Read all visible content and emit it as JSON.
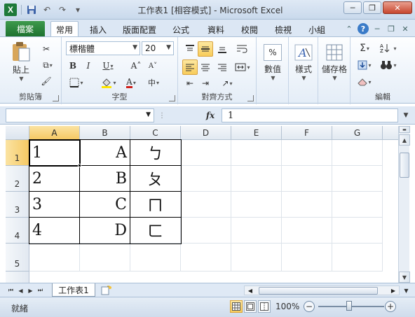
{
  "window": {
    "title": "工作表1 [相容模式] - Microsoft Excel",
    "app_icon": "X"
  },
  "qat": {
    "save_icon": "💾",
    "undo_icon": "↶",
    "redo_icon": "↷",
    "customize_icon": "▾"
  },
  "window_controls": {
    "minimize": "─",
    "restore": "❐",
    "close": "✕"
  },
  "ribbon_tabs": {
    "file": "檔案",
    "tabs": [
      "常用",
      "插入",
      "版面配置",
      "公式",
      "資料",
      "校閱",
      "檢視",
      "小組"
    ],
    "active": "常用"
  },
  "ribbon": {
    "clipboard": {
      "label": "剪貼簿",
      "paste": "貼上"
    },
    "font": {
      "label": "字型",
      "font_name": "標楷體",
      "font_size": "20",
      "bold": "B",
      "italic": "I",
      "underline": "U",
      "grow": "A˄",
      "shrink": "A˅",
      "font_color_letter": "A",
      "phonetic": "中"
    },
    "alignment": {
      "label": "對齊方式"
    },
    "number": {
      "label": "數值",
      "icon_text": "%"
    },
    "styles": {
      "label": "樣式"
    },
    "cells": {
      "label": "儲存格"
    },
    "editing": {
      "label": "編輯",
      "sum": "Σ"
    }
  },
  "formula_bar": {
    "name_box": "",
    "fx": "fx",
    "value": "1"
  },
  "sheet": {
    "columns": [
      "A",
      "B",
      "C",
      "D",
      "E",
      "F",
      "G"
    ],
    "rows": [
      "1",
      "2",
      "3",
      "4",
      "5"
    ],
    "active_column": "A",
    "active_row": "1",
    "cells": {
      "A": [
        "1",
        "2",
        "3",
        "4",
        ""
      ],
      "B": [
        "A",
        "B",
        "C",
        "D",
        ""
      ],
      "C": [
        "ㄅ",
        "ㄆ",
        "ㄇ",
        "ㄈ",
        ""
      ]
    }
  },
  "sheet_tabs": {
    "active": "工作表1"
  },
  "status": {
    "mode": "就緒",
    "zoom": "100%"
  },
  "colors": {
    "file_tab": "#1e7330",
    "highlight": "#f8cc5a",
    "accent": "#3a7bc8"
  }
}
